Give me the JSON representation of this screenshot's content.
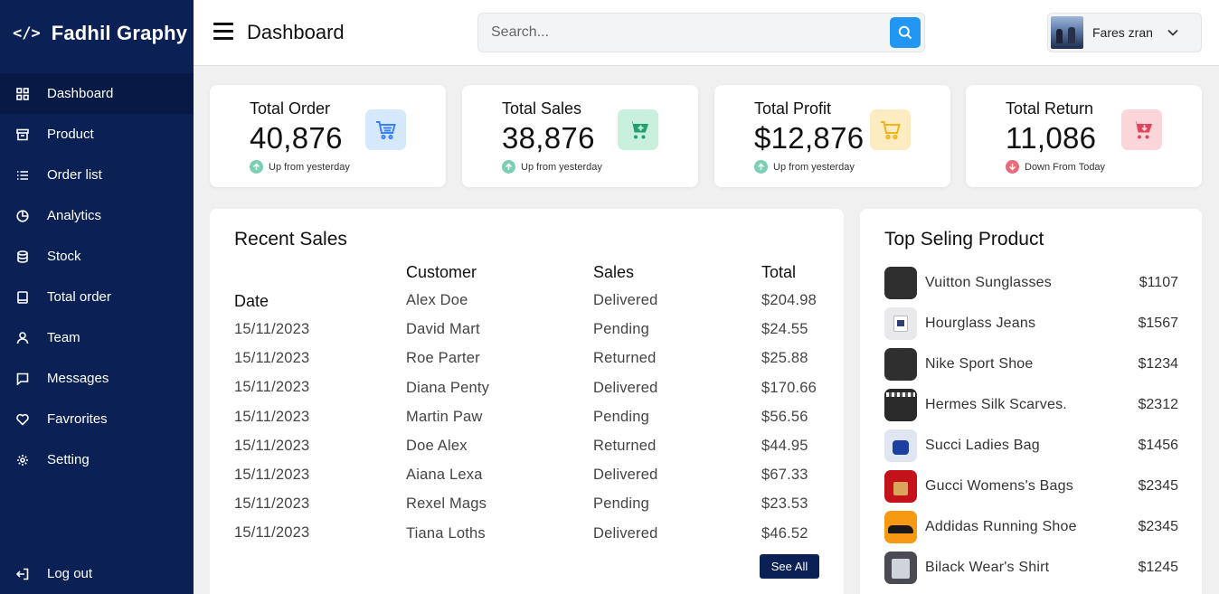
{
  "brand": {
    "icon": "</>",
    "name": "Fadhil Graphy"
  },
  "sidebar": {
    "items": [
      {
        "label": "Dashboard",
        "icon": "grid-icon",
        "active": true
      },
      {
        "label": "Product",
        "icon": "box-icon"
      },
      {
        "label": "Order list",
        "icon": "list-icon"
      },
      {
        "label": "Analytics",
        "icon": "pie-chart-icon"
      },
      {
        "label": "Stock",
        "icon": "database-icon"
      },
      {
        "label": "Total order",
        "icon": "tablet-icon"
      },
      {
        "label": "Team",
        "icon": "user-icon"
      },
      {
        "label": "Messages",
        "icon": "message-icon"
      },
      {
        "label": "Favrorites",
        "icon": "heart-icon"
      },
      {
        "label": "Setting",
        "icon": "gear-icon"
      }
    ],
    "logout": "Log out"
  },
  "header": {
    "title": "Dashboard",
    "search_placeholder": "Search...",
    "user_name": "Fares zran"
  },
  "stats": [
    {
      "label": "Total Order",
      "value": "40,876",
      "trend": "Up from yesterday",
      "direction": "up",
      "icon": "cart-icon",
      "icon_color": "#3b82f6",
      "icon_bg": "#d6e8fb"
    },
    {
      "label": "Total Sales",
      "value": "38,876",
      "trend": "Up from yesterday",
      "direction": "up",
      "icon": "cart-plus-icon",
      "icon_color": "#22a06b",
      "icon_bg": "#c8f0dc"
    },
    {
      "label": "Total Profit",
      "value": "$12,876",
      "trend": "Up from yesterday",
      "direction": "up",
      "icon": "cart-icon",
      "icon_color": "#f2b318",
      "icon_bg": "#fdecc2"
    },
    {
      "label": "Total Return",
      "value": "11,086",
      "trend": "Down From Today",
      "direction": "down",
      "icon": "cart-down-icon",
      "icon_color": "#e0455c",
      "icon_bg": "#fbd5da"
    }
  ],
  "recent_sales": {
    "title": "Recent Sales",
    "headers": {
      "date": "Date",
      "customer": "Customer",
      "sales": "Sales",
      "total": "Total"
    },
    "dates": [
      "15/11/2023",
      "15/11/2023",
      "15/11/2023",
      "15/11/2023",
      "15/11/2023",
      "15/11/2023",
      "15/11/2023",
      "15/11/2023"
    ],
    "customers": [
      "Alex Doe",
      "David Mart",
      "Roe Parter",
      "Diana Penty",
      "Martin Paw",
      "Doe Alex",
      "Aiana Lexa",
      "Rexel Mags",
      "Tiana Loths"
    ],
    "statuses": [
      "Delivered",
      "Pending",
      "Returned",
      "Delivered",
      "Pending",
      "Returned",
      "Delivered",
      "Pending",
      "Delivered"
    ],
    "totals": [
      "$204.98",
      "$24.55",
      "$25.88",
      "$170.66",
      "$56.56",
      "$44.95",
      "$67.33",
      "$23.53",
      "$46.52"
    ],
    "see_all": "See All"
  },
  "top_selling": {
    "title": "Top Seling Product",
    "products": [
      {
        "name": "Vuitton Sunglasses",
        "price": "$1107"
      },
      {
        "name": "Hourglass Jeans",
        "price": "$1567"
      },
      {
        "name": "Nike Sport Shoe",
        "price": "$1234"
      },
      {
        "name": "Hermes Silk Scarves.",
        "price": "$2312"
      },
      {
        "name": "Succi Ladies Bag",
        "price": "$1456"
      },
      {
        "name": "Gucci Womens's Bags",
        "price": "$2345"
      },
      {
        "name": "Addidas Running Shoe",
        "price": "$2345"
      },
      {
        "name": "Bilack Wear's Shirt",
        "price": "$1245"
      }
    ]
  },
  "colors": {
    "sidebar_bg": "#0b2155",
    "accent_blue": "#2196f3",
    "trend_up": "#7bcfb4",
    "trend_down": "#e86a7b"
  }
}
